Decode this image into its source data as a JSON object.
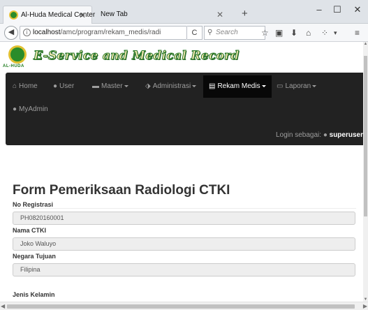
{
  "browser": {
    "tabs": [
      {
        "title": "Al-Huda Medical Center",
        "active": true
      },
      {
        "title": "New Tab",
        "active": false
      }
    ],
    "url": {
      "host": "localhost",
      "path": "/amc/program/rekam_medis/radi"
    },
    "search_placeholder": "Search",
    "window_controls": {
      "minimize": "–",
      "maximize": "☐",
      "close": "✕"
    },
    "toolbar_icons": [
      "star-icon",
      "reading-list-icon",
      "download-icon",
      "home-icon",
      "extension-icon",
      "menu-icon"
    ]
  },
  "site": {
    "logo_caption": "AL-HUDA",
    "logo_title": "E-Service and Medical Record"
  },
  "nav": {
    "items": [
      {
        "label": "Home",
        "icon": "home-icon"
      },
      {
        "label": "User",
        "icon": "user-icon"
      },
      {
        "label": "Master",
        "icon": "list-icon",
        "dropdown": true
      },
      {
        "label": "Administrasi",
        "icon": "tag-icon",
        "dropdown": true
      },
      {
        "label": "Rekam Medis",
        "icon": "book-icon",
        "dropdown": true,
        "active": true
      },
      {
        "label": "Laporan",
        "icon": "document-icon",
        "dropdown": true
      },
      {
        "label": "MyAdmin",
        "icon": "user-icon"
      }
    ],
    "login_prefix": "Login sebagai:",
    "login_user": "superuser"
  },
  "form": {
    "title": "Form Pemeriksaan Radiologi CTKI",
    "fields": [
      {
        "label": "No Registrasi",
        "value": "PH0820160001"
      },
      {
        "label": "Nama CTKI",
        "value": "Joko Waluyo"
      },
      {
        "label": "Negara Tujuan",
        "value": "Filipina"
      },
      {
        "label": "Jenis Kelamin",
        "value": ""
      }
    ]
  },
  "colors": {
    "navbar_bg": "#222222",
    "navbar_active": "#080808",
    "accent_green": "#2a8c2a"
  }
}
